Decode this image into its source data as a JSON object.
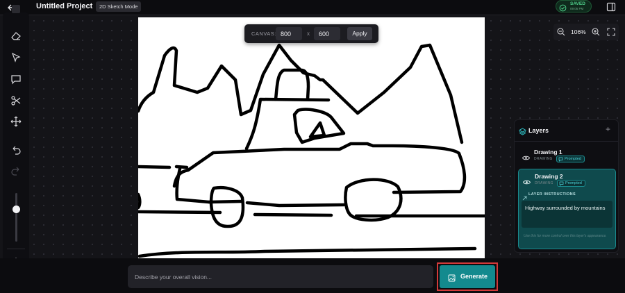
{
  "header": {
    "back_icon": "arrow-left-icon",
    "project_title": "Untitled Project",
    "mode_badge": "2D Sketch Mode",
    "save_status": {
      "label": "SAVED",
      "time": "09:05 PM",
      "color": "#4fd18b",
      "icon": "check-circle-icon"
    },
    "panel_toggle_icon": "sidebar-panel-icon"
  },
  "toolbar": {
    "tools": [
      {
        "name": "brush-icon"
      },
      {
        "name": "eraser-icon"
      },
      {
        "name": "pointer-icon"
      },
      {
        "name": "comment-icon"
      },
      {
        "name": "scissors-icon"
      },
      {
        "name": "move-icon"
      },
      {
        "name": "undo-icon"
      },
      {
        "name": "redo-icon"
      }
    ],
    "brush_size_level": 0.72,
    "export_icon": "upload-icon"
  },
  "canvas_settings": {
    "label": "CANVAS:",
    "width": "800",
    "separator": "x",
    "height": "600",
    "apply_label": "Apply"
  },
  "zoom": {
    "out_icon": "zoom-out-icon",
    "level": "106%",
    "in_icon": "zoom-in-icon",
    "fit_icon": "fit-screen-icon"
  },
  "layers": {
    "title": "Layers",
    "add_icon": "plus-icon",
    "items": [
      {
        "name": "Drawing 1",
        "type": "DRAWING",
        "badge": "Prompted",
        "selected": false
      },
      {
        "name": "Drawing 2",
        "type": "DRAWING",
        "badge": "Prompted",
        "selected": true,
        "instructions_label": "LAYER INSTRUCTIONS",
        "instructions_text": "Highway surrounded by mountains",
        "hint": "Use this for more control over this layer's appearance."
      }
    ]
  },
  "bottom": {
    "vision_placeholder": "Describe your overall vision...",
    "generate_label": "Generate",
    "accent": "#138a8e",
    "highlight": "#d23a3a"
  }
}
